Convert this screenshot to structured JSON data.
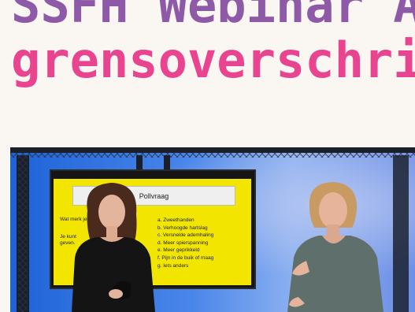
{
  "page": {
    "title_line1": "SSFH Webinar A",
    "title_line2": "grensoverschri"
  },
  "video": {
    "poll": {
      "title": "Pollvraag",
      "question_part1": "Wat merk je",
      "question_part2": "Je kunt\ngeven.",
      "options": [
        "a. Zweethanden",
        "b. Verhoogde hartslag",
        "c. Versnelde ademhaling",
        "d. Meer spierspanning",
        "e. Meer geprikkeld",
        "f. Pijn in de buik of maag",
        "g. Iets anders"
      ]
    }
  },
  "colors": {
    "title_purple": "#8e5aa8",
    "title_pink": "#e9448f",
    "background": "#faf7f2",
    "screen_yellow": "#f2e600"
  }
}
